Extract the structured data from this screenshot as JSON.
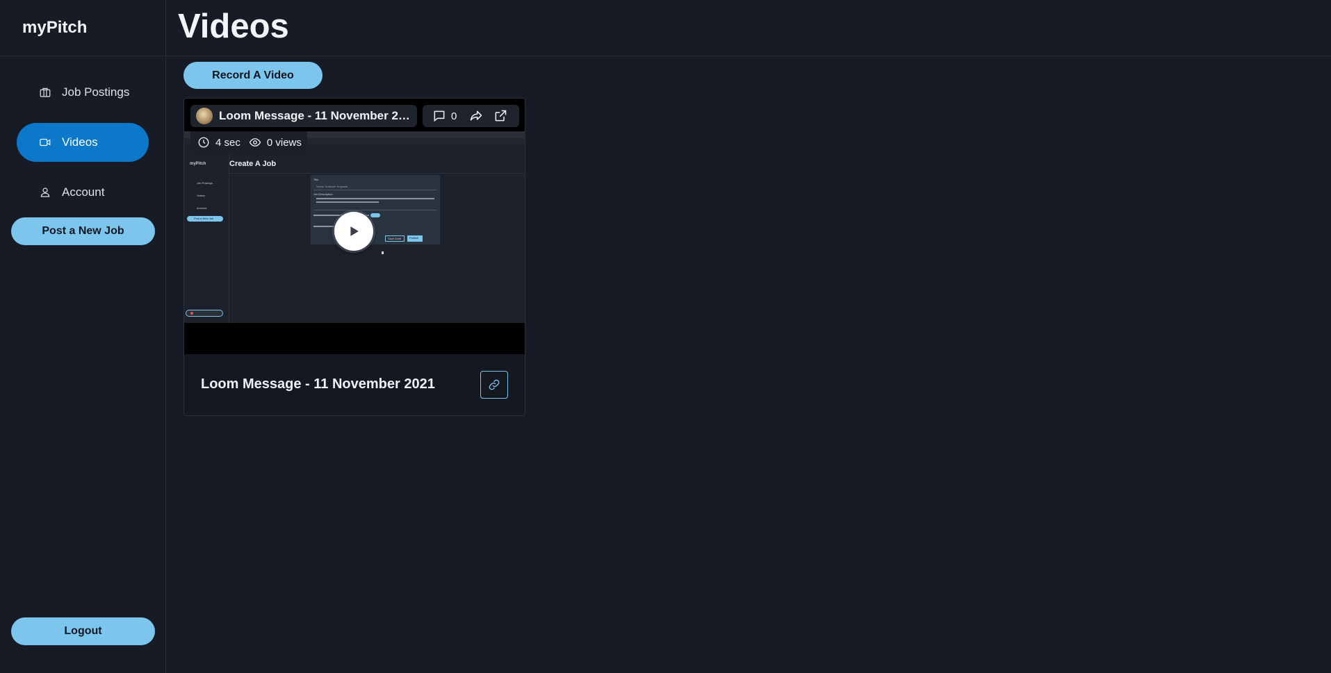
{
  "app": {
    "brand": "myPitch"
  },
  "sidebar": {
    "items": [
      {
        "label": "Job Postings",
        "icon": "briefcase-icon",
        "active": false
      },
      {
        "label": "Videos",
        "icon": "video-camera-icon",
        "active": true
      },
      {
        "label": "Account",
        "icon": "user-icon",
        "active": false
      }
    ],
    "post_job_label": "Post a New Job",
    "logout_label": "Logout"
  },
  "header": {
    "title": "Videos"
  },
  "toolbar": {
    "record_label": "Record A Video"
  },
  "video_card": {
    "embed_title": "Loom Message - 11 November 2…",
    "comment_count": "0",
    "duration": "4 sec",
    "views": "0 views",
    "title": "Loom Message - 11 November 2021",
    "thumbnail": {
      "brand": "myPitch",
      "page_title": "Create A Job",
      "nav_items": [
        "Job Postings",
        "Videos",
        "Account"
      ],
      "post_button": "Post a New Job",
      "form_title_label": "Title",
      "form_title_value": "Senior Software Engineer",
      "form_desc_label": "Job Description",
      "form_save": "Save Draft",
      "form_publish": "Publish"
    }
  },
  "colors": {
    "background": "#161b26",
    "accent": "#7cc6ee",
    "active_nav": "#0b78c9"
  }
}
